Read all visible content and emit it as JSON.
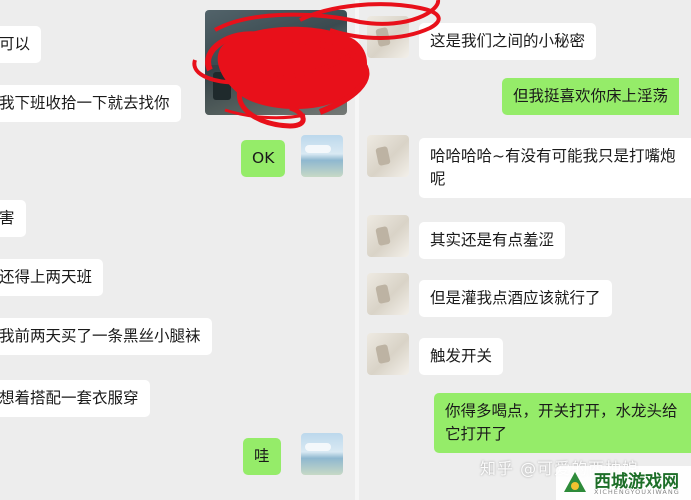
{
  "left_chat": {
    "messages": [
      {
        "text": "可以"
      },
      {
        "text": "我下班收拾一下就去找你"
      },
      {
        "text": "OK"
      },
      {
        "text": "害"
      },
      {
        "text": "还得上两天班"
      },
      {
        "text": "我前两天买了一条黑丝小腿袜"
      },
      {
        "text": "想着搭配一套衣服穿"
      },
      {
        "text": "哇"
      }
    ]
  },
  "right_chat": {
    "messages": [
      {
        "text": "这是我们之间的小秘密"
      },
      {
        "text": "但我挺喜欢你床上淫荡"
      },
      {
        "text": "哈哈哈哈~有没有可能我只是打嘴炮呢"
      },
      {
        "text": "其实还是有点羞涩"
      },
      {
        "text": "但是灌我点酒应该就行了"
      },
      {
        "text": "触发开关"
      },
      {
        "text": "你得多喝点，开关打开，水龙头给它打开了"
      }
    ]
  },
  "watermark": {
    "text": "知乎 @可爱的西柚娘"
  },
  "logo": {
    "name": "西城游戏网",
    "subtitle": "XICHENGYOUXIWANG"
  },
  "colors": {
    "outgoing": "#95ec69",
    "incoming": "#ffffff",
    "background": "#ededed",
    "scribble": "#e8101a"
  }
}
